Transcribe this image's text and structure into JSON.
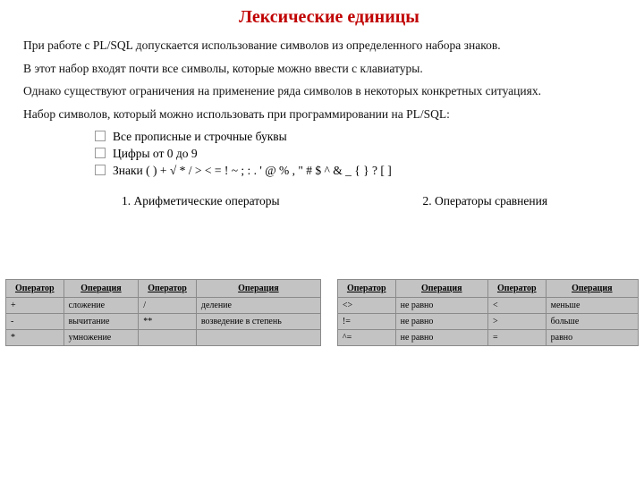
{
  "title": "Лексические единицы",
  "paragraphs": [
    "При работе с PL/SQL допускается использование символов из определенного набора знаков.",
    "В этот набор входят почти все символы, которые можно ввести с клавиатуры.",
    "Однако существуют ограничения на применение ряда символов в некоторых конкретных ситуациях.",
    "Набор символов, который можно использовать при программировании на PL/SQL:"
  ],
  "bullets": [
    "Все прописные и строчные буквы",
    "Цифры от 0 до 9",
    "Знаки ( ) + √ * / > < = ! ~ ; : . ' @ % , \" # $ ^ & _ { } ? [ ]"
  ],
  "subtitle1": "1. Арифметические операторы",
  "subtitle2": "2. Операторы сравнения",
  "table1": {
    "headers": [
      "Оператор",
      "Операция",
      "Оператор",
      "Операция"
    ],
    "rows": [
      [
        "+",
        "сложение",
        "/",
        "деление"
      ],
      [
        "-",
        "вычитание",
        "**",
        "возведение в степень"
      ],
      [
        "*",
        "умножение",
        "",
        ""
      ]
    ]
  },
  "table2": {
    "headers": [
      "Оператор",
      "Операция",
      "Оператор",
      "Операция"
    ],
    "rows": [
      [
        "<>",
        "не равно",
        "<",
        "меньше"
      ],
      [
        "!=",
        "не равно",
        ">",
        "больше"
      ],
      [
        "^=",
        "не равно",
        "=",
        "равно"
      ]
    ]
  }
}
